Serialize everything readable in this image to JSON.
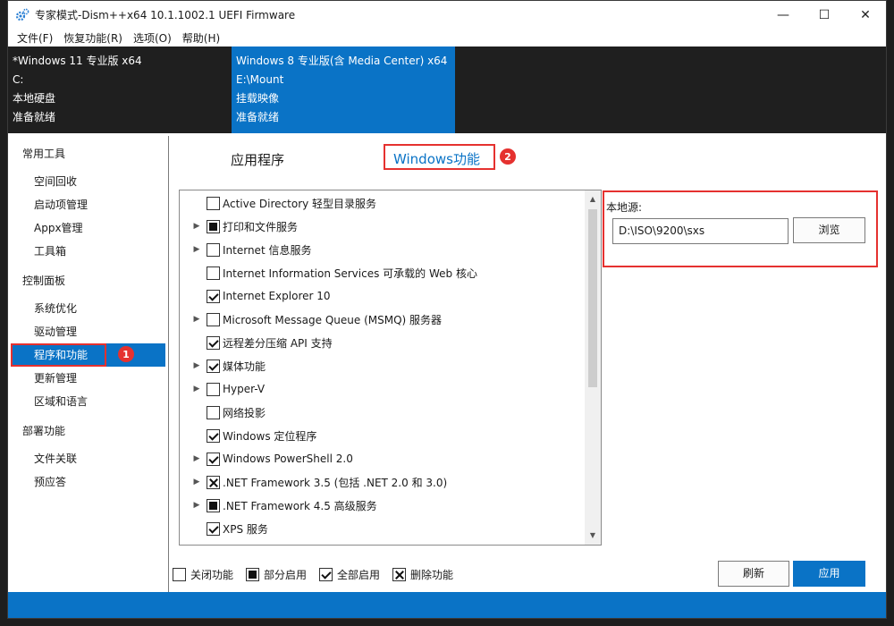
{
  "window": {
    "title": "专家模式-Dism++x64 10.1.1002.1 UEFI Firmware",
    "controls": {
      "minimize": "—",
      "maximize": "☐",
      "close": "✕"
    }
  },
  "menu": [
    "文件(F)",
    "恢复功能(R)",
    "选项(O)",
    "帮助(H)"
  ],
  "images": [
    {
      "name": "*Windows 11 专业版 x64",
      "path": "C:",
      "type": "本地硬盘",
      "status": "准备就绪",
      "active": false
    },
    {
      "name": "Windows 8 专业版(含 Media Center) x64",
      "path": "E:\\Mount",
      "type": "挂载映像",
      "status": "准备就绪",
      "active": true
    }
  ],
  "sidebar": {
    "sections": [
      {
        "title": "常用工具",
        "items": [
          "空间回收",
          "启动项管理",
          "Appx管理",
          "工具箱"
        ]
      },
      {
        "title": "控制面板",
        "items": [
          "系统优化",
          "驱动管理",
          "程序和功能",
          "更新管理",
          "区域和语言"
        ]
      },
      {
        "title": "部署功能",
        "items": [
          "文件关联",
          "预应答"
        ]
      }
    ],
    "active_item": "程序和功能"
  },
  "tabs": {
    "programs": "应用程序",
    "features": "Windows功能"
  },
  "annotations": {
    "badge1": "1",
    "badge2": "2"
  },
  "features": [
    {
      "label": "Active Directory 轻型目录服务",
      "state": "unchecked",
      "expandable": false
    },
    {
      "label": "打印和文件服务",
      "state": "partial",
      "expandable": true
    },
    {
      "label": "Internet 信息服务",
      "state": "unchecked",
      "expandable": true
    },
    {
      "label": "Internet Information Services 可承载的 Web 核心",
      "state": "unchecked",
      "expandable": false
    },
    {
      "label": "Internet Explorer 10",
      "state": "checked",
      "expandable": false
    },
    {
      "label": "Microsoft Message Queue (MSMQ) 服务器",
      "state": "unchecked",
      "expandable": true
    },
    {
      "label": "远程差分压缩 API 支持",
      "state": "checked",
      "expandable": false
    },
    {
      "label": "媒体功能",
      "state": "checked",
      "expandable": true
    },
    {
      "label": "Hyper-V",
      "state": "unchecked",
      "expandable": true
    },
    {
      "label": "网络投影",
      "state": "unchecked",
      "expandable": false
    },
    {
      "label": "Windows 定位程序",
      "state": "checked",
      "expandable": false
    },
    {
      "label": "Windows PowerShell 2.0",
      "state": "checked",
      "expandable": true
    },
    {
      "label": ".NET Framework 3.5 (包括 .NET 2.0 和 3.0)",
      "state": "removed",
      "expandable": true
    },
    {
      "label": ".NET Framework 4.5 高级服务",
      "state": "partial",
      "expandable": true
    },
    {
      "label": "XPS 服务",
      "state": "checked",
      "expandable": false
    }
  ],
  "source": {
    "label": "本地源:",
    "value": "D:\\ISO\\9200\\sxs",
    "browse": "浏览"
  },
  "legend": [
    {
      "state": "unchecked",
      "label": "关闭功能"
    },
    {
      "state": "partial",
      "label": "部分启用"
    },
    {
      "state": "checked",
      "label": "全部启用"
    },
    {
      "state": "removed",
      "label": "删除功能"
    }
  ],
  "buttons": {
    "refresh": "刷新",
    "apply": "应用"
  },
  "colors": {
    "accent": "#0a73c6",
    "highlight": "#e5312f",
    "header_bg": "#1f1f1f"
  }
}
